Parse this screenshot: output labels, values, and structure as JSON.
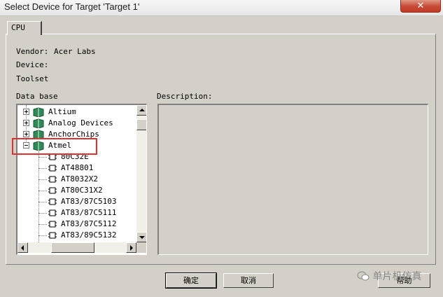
{
  "window": {
    "title": "Select Device for Target 'Target 1'",
    "close_label": "✕"
  },
  "tabs": [
    {
      "label": "CPU"
    }
  ],
  "info": {
    "vendor_label": "Vendor:",
    "vendor_value": "Acer Labs",
    "device_label": "Device:",
    "toolset_label": "Toolset"
  },
  "database": {
    "label": "Data base",
    "vendors": [
      "Altium",
      "Analog Devices",
      "AnchorChips",
      "Atmel"
    ],
    "highlighted_vendor": "Atmel",
    "devices": [
      "80C32E",
      "AT48801",
      "AT8032X2",
      "AT80C31X2",
      "AT83/87C5103",
      "AT83/87C5111",
      "AT83/87C5112",
      "AT83/89C5132"
    ]
  },
  "description": {
    "label": "Description:"
  },
  "buttons": {
    "ok": "确定",
    "cancel": "取消",
    "help": "帮助"
  },
  "watermark": {
    "text": "单片机仿真",
    "icon": "wechat-icon"
  },
  "colors": {
    "highlight": "#e03030",
    "book_green": "#2e8b57"
  }
}
